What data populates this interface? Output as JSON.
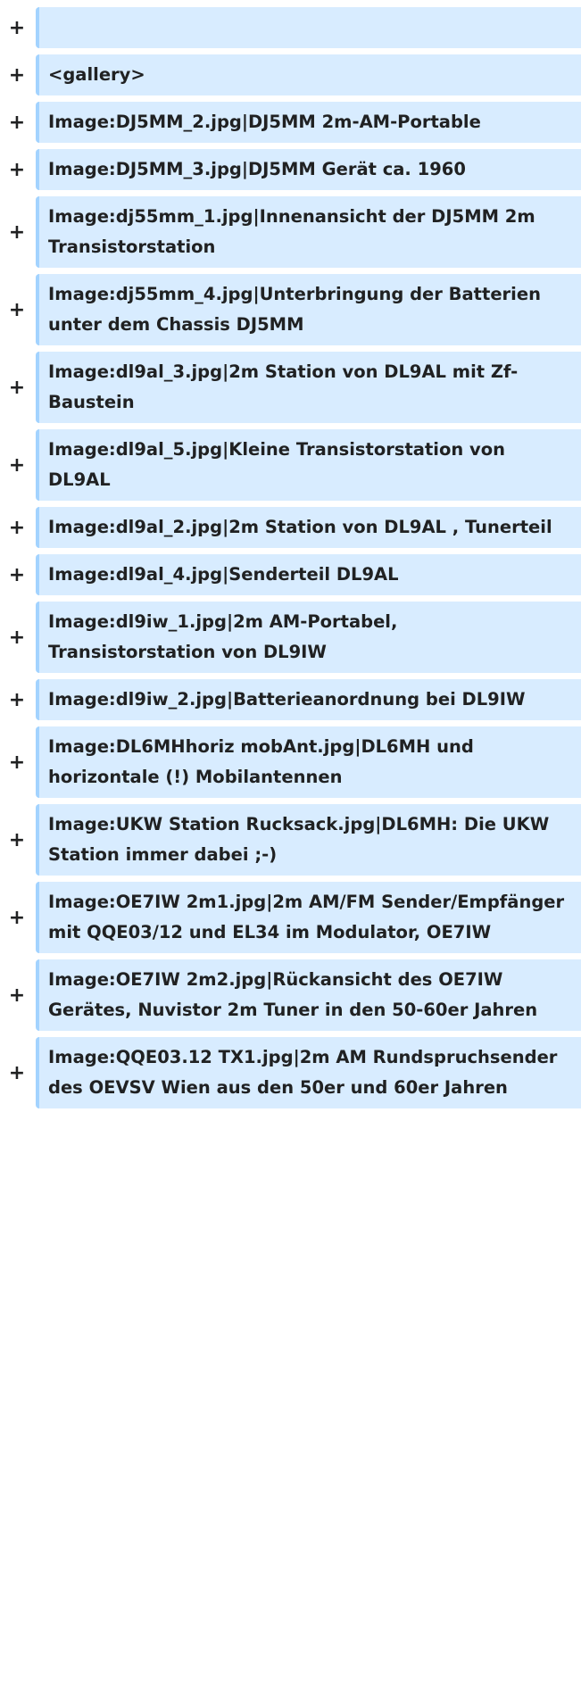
{
  "diff": {
    "marker": "+",
    "lines": [
      "",
      "<gallery>",
      "Image:DJ5MM_2.jpg|DJ5MM 2m-AM-Portable",
      "Image:DJ5MM_3.jpg|DJ5MM Gerät ca. 1960",
      "Image:dj55mm_1.jpg|Innenansicht der DJ5MM 2m Transistorstation",
      "Image:dj55mm_4.jpg|Unterbringung der Batterien unter dem Chassis DJ5MM",
      "Image:dl9al_3.jpg|2m Station von DL9AL mit Zf-Baustein",
      "Image:dl9al_5.jpg|Kleine Transistorstation von DL9AL",
      "Image:dl9al_2.jpg|2m Station von DL9AL , Tunerteil",
      "Image:dl9al_4.jpg|Senderteil DL9AL",
      "Image:dl9iw_1.jpg|2m AM-Portabel, Transistorstation von DL9IW",
      "Image:dl9iw_2.jpg|Batterieanordnung bei DL9IW",
      "Image:DL6MHhoriz mobAnt.jpg|DL6MH und horizontale (!) Mobilantennen",
      "Image:UKW Station Rucksack.jpg|DL6MH: Die UKW Station immer dabei ;-)",
      "Image:OE7IW 2m1.jpg|2m AM/FM Sender/Empfänger mit QQE03/12 und EL34 im Modulator,  OE7IW",
      "Image:OE7IW 2m2.jpg|Rückansicht des OE7IW Gerätes, Nuvistor 2m Tuner in den 50-60er Jahren",
      "Image:QQE03.12 TX1.jpg|2m AM Rundspruchsender des OEVSV Wien aus den 50er und 60er Jahren"
    ]
  }
}
